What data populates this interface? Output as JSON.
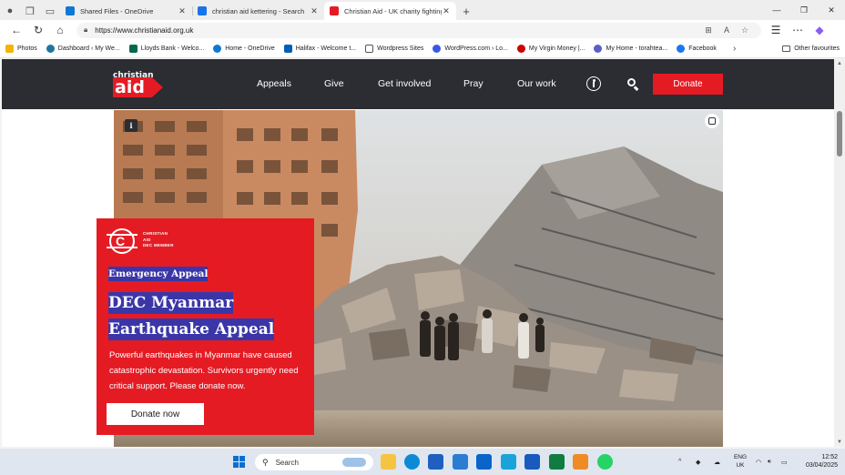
{
  "browser": {
    "tabs": [
      {
        "title": "Shared Files - OneDrive",
        "favicon_color": "#0f78d4",
        "active": false
      },
      {
        "title": "christian aid kettering - Search",
        "favicon_color": "#1a73e8",
        "active": false
      },
      {
        "title": "Christian Aid - UK charity fighting",
        "favicon_color": "#e51b24",
        "active": true
      }
    ],
    "new_tab_label": "+",
    "address_url": "https://www.christianaid.org.uk",
    "bookmarks": [
      {
        "label": "Photos",
        "color": "#f4b400"
      },
      {
        "label": "Dashboard ‹ My We...",
        "color": "#21759b"
      },
      {
        "label": "Lloyds Bank - Welco...",
        "color": "#006a4d"
      },
      {
        "label": "Home - OneDrive",
        "color": "#0f78d4"
      },
      {
        "label": "Halifax - Welcome t...",
        "color": "#005eb8"
      },
      {
        "label": "Wordpress Sites",
        "color": "#ffffff"
      },
      {
        "label": "WordPress.com › Lo...",
        "color": "#3858e9"
      },
      {
        "label": "My Virgin Money |...",
        "color": "#cc0000"
      },
      {
        "label": "My Home - torahtea...",
        "color": "#5b5fc7"
      },
      {
        "label": "Facebook",
        "color": "#1877f2"
      }
    ],
    "other_favourites": "Other favourites"
  },
  "site": {
    "logo_small": "christian",
    "logo_big": "aid",
    "nav": [
      "Appeals",
      "Give",
      "Get involved",
      "Pray",
      "Our work"
    ],
    "donate_label": "Donate",
    "info_label": "i"
  },
  "appeal": {
    "dec_line1": "CHRISTIAN",
    "dec_line2": "AID",
    "dec_line3": "DEC MEMBER",
    "eyebrow": "Emergency Appeal",
    "title_line1": "DEC Myanmar",
    "title_line2": "Earthquake Appeal",
    "body": "Powerful earthquakes in Myanmar have caused catastrophic devastation. Survivors urgently need critical support. Please donate now.",
    "cta": "Donate now"
  },
  "taskbar": {
    "search_placeholder": "Search",
    "lang_line1": "ENG",
    "lang_line2": "UK",
    "time": "12:52",
    "date": "03/04/2025",
    "apps": [
      {
        "name": "file-explorer",
        "color": "#f5c542"
      },
      {
        "name": "edge",
        "color": "#0c8ad6"
      },
      {
        "name": "store",
        "color": "#1f5fbf"
      },
      {
        "name": "calculator-app",
        "color": "#2b7cd3"
      },
      {
        "name": "outlook",
        "color": "#0a64c9"
      },
      {
        "name": "remote-desktop",
        "color": "#1aa3d9"
      },
      {
        "name": "word",
        "color": "#185abd"
      },
      {
        "name": "excel",
        "color": "#107c41"
      },
      {
        "name": "photos-app",
        "color": "#f08a24"
      },
      {
        "name": "whatsapp",
        "color": "#25d366"
      }
    ]
  }
}
